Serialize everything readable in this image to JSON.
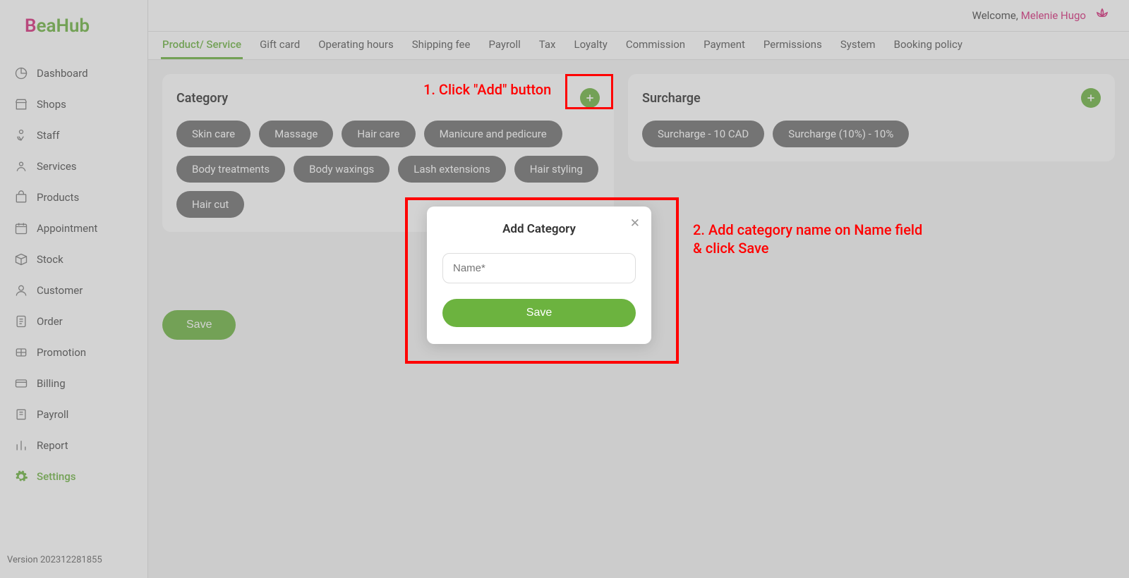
{
  "logo": {
    "prefix": "B",
    "rest": "eaHub"
  },
  "welcome": {
    "text": "Welcome,",
    "user": "Melenie Hugo"
  },
  "version": "Version 202312281855",
  "sidebar": [
    {
      "label": "Dashboard",
      "icon": "gauge-icon"
    },
    {
      "label": "Shops",
      "icon": "shop-icon"
    },
    {
      "label": "Staff",
      "icon": "staff-icon"
    },
    {
      "label": "Services",
      "icon": "services-icon"
    },
    {
      "label": "Products",
      "icon": "products-icon"
    },
    {
      "label": "Appointment",
      "icon": "calendar-icon"
    },
    {
      "label": "Stock",
      "icon": "stock-icon"
    },
    {
      "label": "Customer",
      "icon": "customer-icon"
    },
    {
      "label": "Order",
      "icon": "order-icon"
    },
    {
      "label": "Promotion",
      "icon": "promotion-icon"
    },
    {
      "label": "Billing",
      "icon": "billing-icon"
    },
    {
      "label": "Payroll",
      "icon": "payroll-icon"
    },
    {
      "label": "Report",
      "icon": "report-icon"
    },
    {
      "label": "Settings",
      "icon": "settings-icon",
      "active": true
    }
  ],
  "tabs": [
    {
      "label": "Product/ Service",
      "active": true
    },
    {
      "label": "Gift card"
    },
    {
      "label": "Operating hours"
    },
    {
      "label": "Shipping fee"
    },
    {
      "label": "Payroll"
    },
    {
      "label": "Tax"
    },
    {
      "label": "Loyalty"
    },
    {
      "label": "Commission"
    },
    {
      "label": "Payment"
    },
    {
      "label": "Permissions"
    },
    {
      "label": "System"
    },
    {
      "label": "Booking policy"
    }
  ],
  "categoryPanel": {
    "title": "Category",
    "items": [
      "Skin care",
      "Massage",
      "Hair care",
      "Manicure and pedicure",
      "Body treatments",
      "Body waxings",
      "Lash extensions",
      "Hair styling",
      "Hair cut"
    ]
  },
  "surchargePanel": {
    "title": "Surcharge",
    "items": [
      "Surcharge - 10 CAD",
      "Surcharge (10%) - 10%"
    ]
  },
  "saveButton": "Save",
  "modal": {
    "title": "Add Category",
    "placeholder": "Name*",
    "save": "Save"
  },
  "annotations": {
    "a1": "1. Click \"Add\" button",
    "a2": "2. Add category name on Name field\n& click Save"
  }
}
